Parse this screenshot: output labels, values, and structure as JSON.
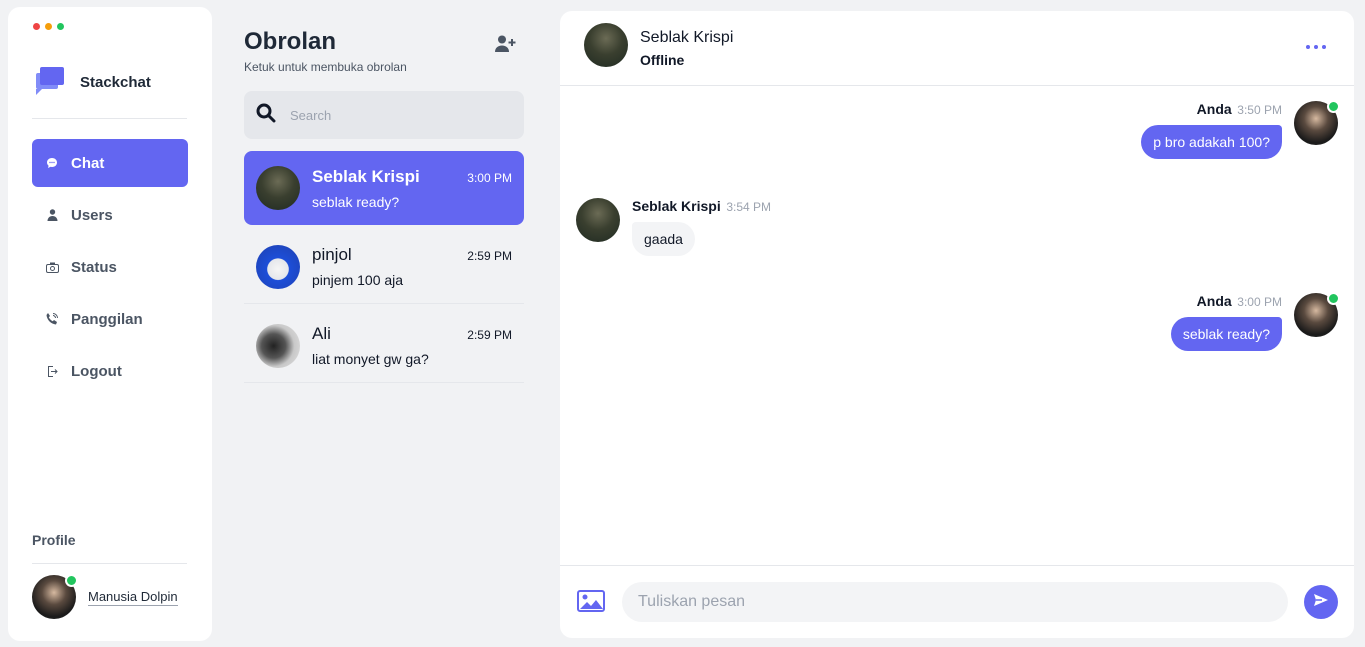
{
  "window": {
    "dots": [
      "#ef4444",
      "#f59e0b",
      "#22c55e"
    ]
  },
  "brand": {
    "name": "Stackchat",
    "accent": "#6366f1"
  },
  "nav": [
    {
      "label": "Chat",
      "icon": "chat-bubble-icon",
      "active": true
    },
    {
      "label": "Users",
      "icon": "user-icon",
      "active": false
    },
    {
      "label": "Status",
      "icon": "camera-icon",
      "active": false
    },
    {
      "label": "Panggilan",
      "icon": "phone-icon",
      "active": false
    },
    {
      "label": "Logout",
      "icon": "logout-icon",
      "active": false
    }
  ],
  "profile": {
    "label": "Profile",
    "name": "Manusia Dolpin",
    "online": true
  },
  "list": {
    "title": "Obrolan",
    "subtitle": "Ketuk untuk membuka obrolan",
    "search_placeholder": "Search",
    "conversations": [
      {
        "name": "Seblak Krispi",
        "time": "3:00 PM",
        "last": "seblak ready?",
        "active": true
      },
      {
        "name": "pinjol",
        "time": "2:59 PM",
        "last": "pinjem 100 aja",
        "active": false
      },
      {
        "name": "Ali",
        "time": "2:59 PM",
        "last": "liat monyet gw ga?",
        "active": false
      }
    ]
  },
  "chat": {
    "name": "Seblak Krispi",
    "status": "Offline",
    "messages": [
      {
        "sender": "Anda",
        "time": "3:50 PM",
        "text": "p bro adakah 100?",
        "outgoing": true
      },
      {
        "sender": "Seblak Krispi",
        "time": "3:54 PM",
        "text": "gaada",
        "outgoing": false
      },
      {
        "sender": "Anda",
        "time": "3:00 PM",
        "text": "seblak ready?",
        "outgoing": true
      }
    ],
    "input_placeholder": "Tuliskan pesan"
  }
}
